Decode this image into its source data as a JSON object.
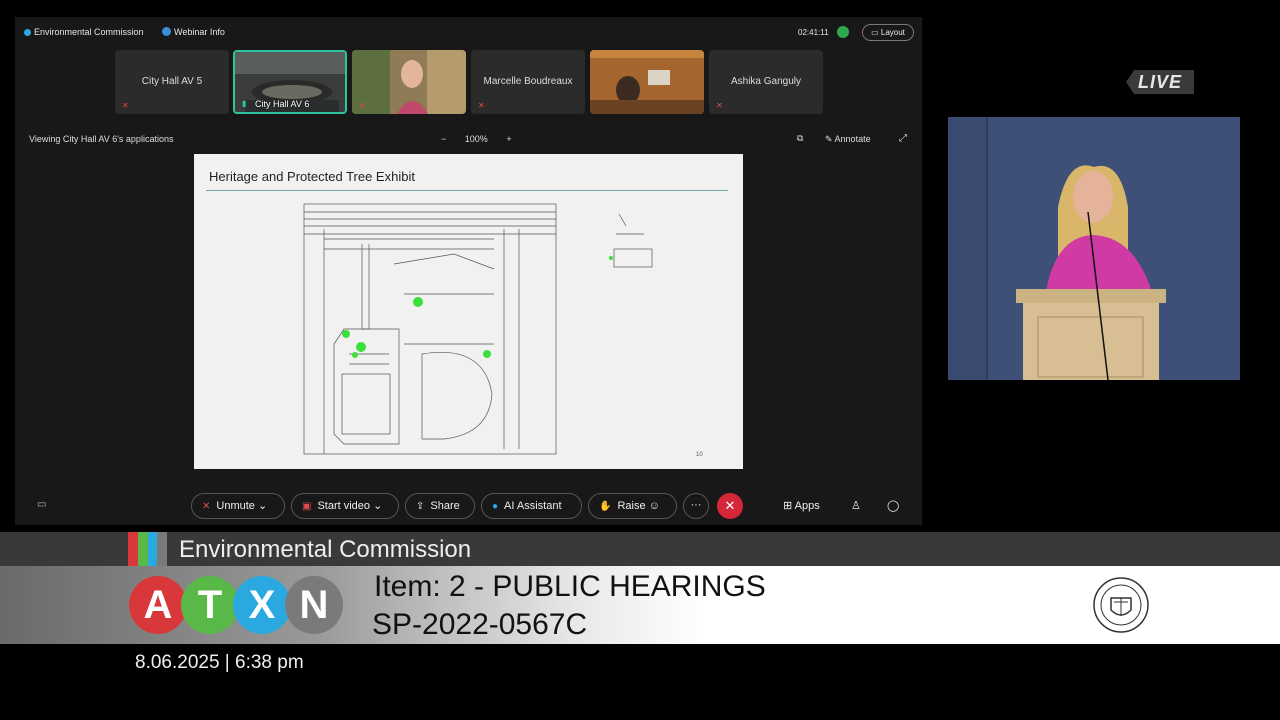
{
  "title_bar": {
    "app_name": "Environmental Commission",
    "webinar_info": "Webinar Info",
    "timer": "02:41:11",
    "layout_label": "Layout"
  },
  "participants": [
    {
      "name": "City Hall AV 5",
      "muted": true,
      "video": false
    },
    {
      "name": "City Hall AV 6",
      "muted": false,
      "video": true,
      "active": true
    },
    {
      "name": "",
      "muted": true,
      "video": true
    },
    {
      "name": "Marcelle Boudreaux",
      "muted": true,
      "video": false
    },
    {
      "name": "",
      "muted": false,
      "video": true
    },
    {
      "name": "Ashika Ganguly",
      "muted": true,
      "video": false
    }
  ],
  "share_bar": {
    "viewing_text": "Viewing City Hall AV 6's applications",
    "zoom_out": "−",
    "zoom_level": "100%",
    "zoom_in": "+",
    "annotate_label": "Annotate"
  },
  "slide": {
    "title": "Heritage and Protected Tree Exhibit",
    "page_number": "10"
  },
  "toolbar": {
    "unmute": "Unmute",
    "start_video": "Start video",
    "share": "Share",
    "ai_assistant": "AI Assistant",
    "raise": "Raise",
    "more": "···",
    "apps": "Apps"
  },
  "live_badge": "LIVE",
  "lower_third": {
    "commission": "Environmental Commission",
    "logo_letters": [
      "A",
      "T",
      "X",
      "N"
    ],
    "item": "Item: 2 - PUBLIC HEARINGS",
    "case_number": "SP-2022-0567C",
    "datetime": "8.06.2025 | 6:38 pm",
    "stripe_colors": [
      "#d8383a",
      "#59b948",
      "#2aa9e0",
      "#7a7a7a"
    ],
    "logo_colors": [
      "#d8383a",
      "#59b948",
      "#2aa9e0",
      "#7a7a7a"
    ]
  }
}
